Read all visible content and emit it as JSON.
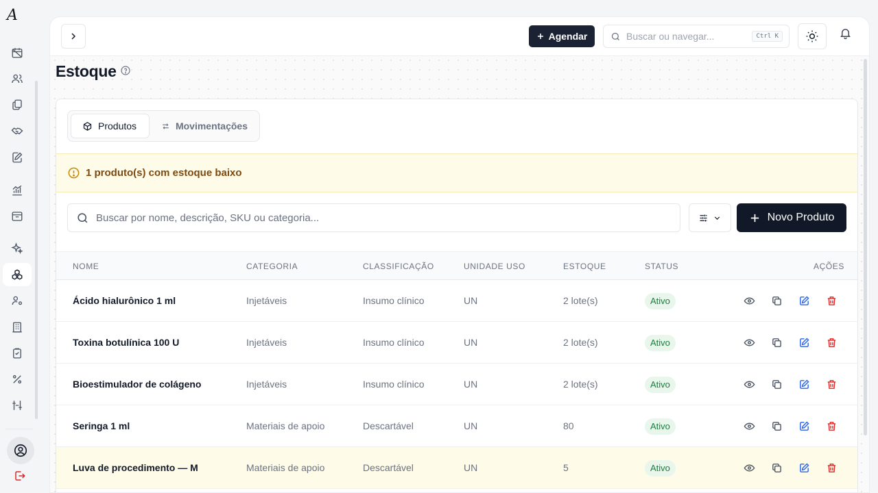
{
  "topbar": {
    "agendar_label": "Agendar",
    "search_placeholder": "Buscar ou navegar...",
    "search_shortcut": "Ctrl K"
  },
  "page": {
    "title": "Estoque"
  },
  "tabs": [
    {
      "label": "Produtos",
      "active": true
    },
    {
      "label": "Movimentações",
      "active": false
    }
  ],
  "alert": {
    "text": "1 produto(s) com estoque baixo"
  },
  "toolbar": {
    "search_placeholder": "Buscar por nome, descrição, SKU ou categoria...",
    "novo_label": "Novo Produto"
  },
  "table": {
    "headers": {
      "nome": "NOME",
      "categoria": "CATEGORIA",
      "classificacao": "CLASSIFICAÇÃO",
      "unidade": "UNIDADE USO",
      "estoque": "ESTOQUE",
      "status": "STATUS",
      "acoes": "AÇÕES"
    },
    "rows": [
      {
        "nome": "Ácido hialurônico 1 ml",
        "categoria": "Injetáveis",
        "classificacao": "Insumo clínico",
        "unidade": "UN",
        "estoque": "2 lote(s)",
        "status": "Ativo"
      },
      {
        "nome": "Toxina botulínica 100 U",
        "categoria": "Injetáveis",
        "classificacao": "Insumo clínico",
        "unidade": "UN",
        "estoque": "2 lote(s)",
        "status": "Ativo"
      },
      {
        "nome": "Bioestimulador de colágeno",
        "categoria": "Injetáveis",
        "classificacao": "Insumo clínico",
        "unidade": "UN",
        "estoque": "2 lote(s)",
        "status": "Ativo"
      },
      {
        "nome": "Seringa 1 ml",
        "categoria": "Materiais de apoio",
        "classificacao": "Descartável",
        "unidade": "UN",
        "estoque": "80",
        "status": "Ativo"
      },
      {
        "nome": "Luva de procedimento — M",
        "categoria": "Materiais de apoio",
        "classificacao": "Descartável",
        "unidade": "UN",
        "estoque": "5",
        "status": "Ativo"
      }
    ]
  },
  "colors": {
    "primary": "#111827",
    "alert_bg": "#fefbe8",
    "alert_text": "#7c4a10",
    "badge_bg": "#e8f6ec",
    "badge_text": "#16803c",
    "edit": "#2563eb",
    "delete": "#dc2626"
  },
  "icons": {
    "sidebar": [
      "calendar-off-icon",
      "users-icon",
      "documents-icon",
      "handshake-icon",
      "edit-note-icon",
      "chart-icon",
      "inbox-icon",
      "sparkles-icon",
      "stock-boxes-icon",
      "user-settings-icon",
      "building-icon",
      "clipboard-icon",
      "percent-icon",
      "scale-icon"
    ]
  }
}
